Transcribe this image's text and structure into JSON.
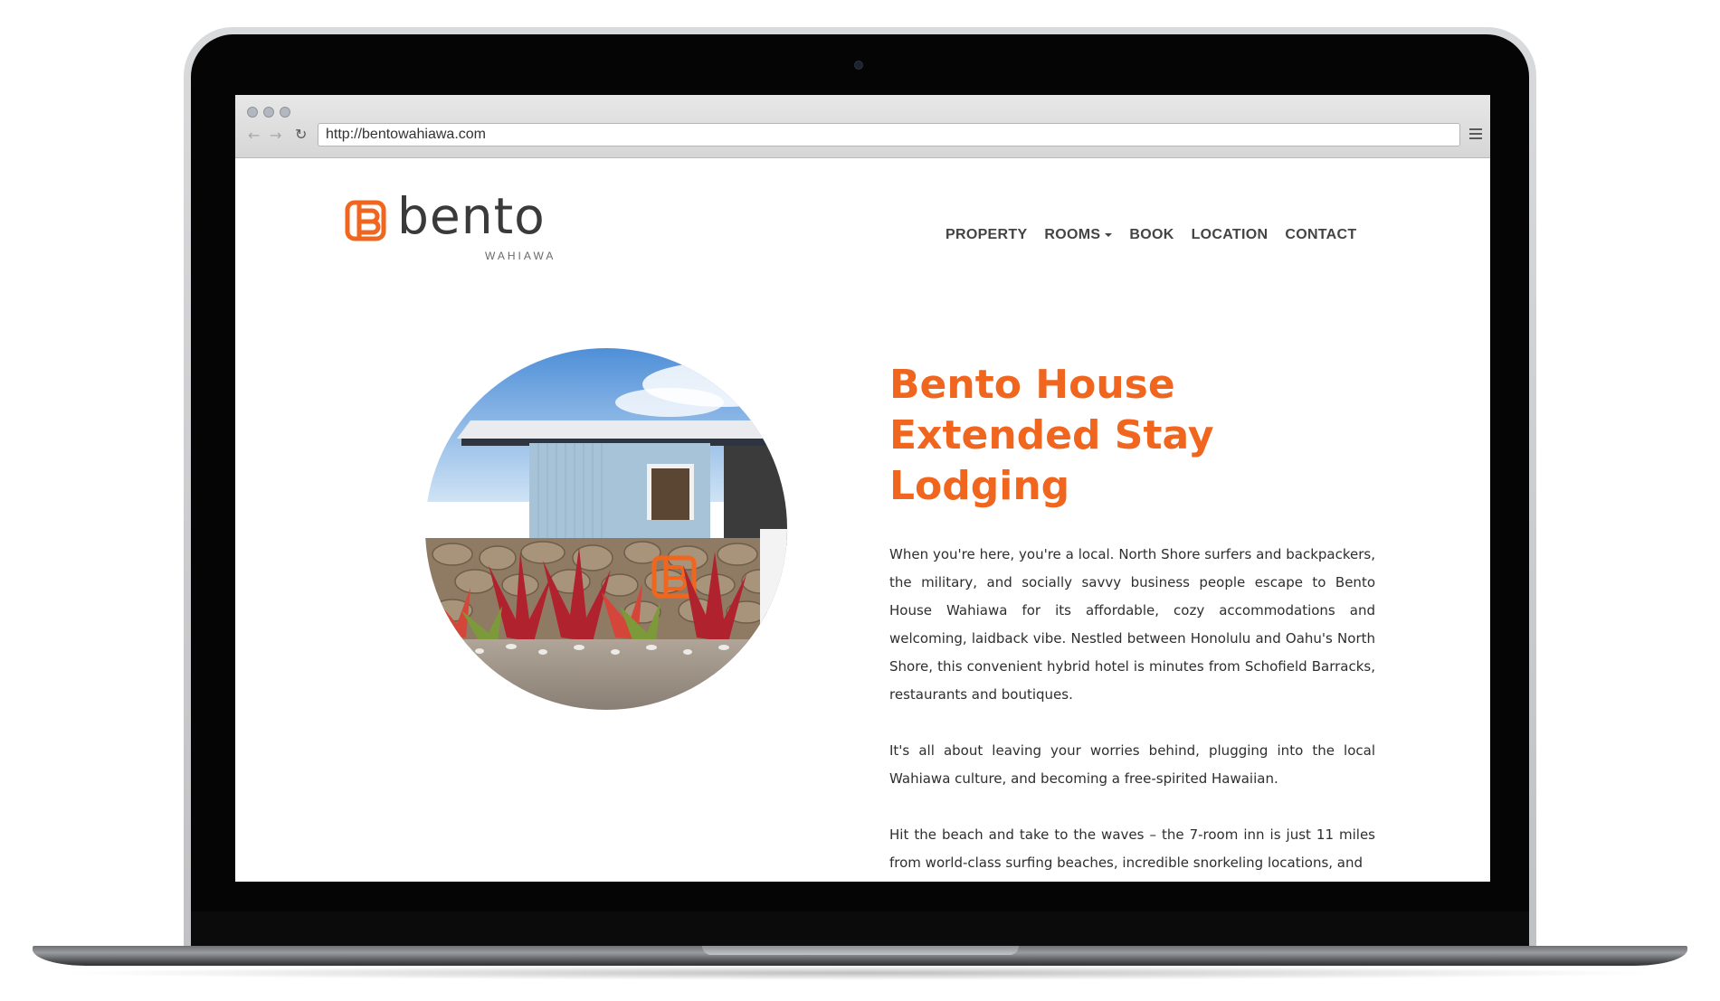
{
  "browser": {
    "url": "http://bentowahiawa.com"
  },
  "site": {
    "logo_word": "bento",
    "logo_sub": "WAHIAWA",
    "brand_color": "#f0661f"
  },
  "nav": {
    "items": [
      {
        "label": "PROPERTY"
      },
      {
        "label": "ROOMS"
      },
      {
        "label": "BOOK"
      },
      {
        "label": "LOCATION"
      },
      {
        "label": "CONTACT"
      }
    ]
  },
  "main": {
    "headline": "Bento House Extended Stay Lodging",
    "paragraphs": [
      "When you're here, you're a local. North Shore surfers and backpackers, the military, and socially savvy business people escape to Bento House Wahiawa for its affordable, cozy accommodations and welcoming, laidback vibe. Nestled between Honolulu and Oahu's North Shore, this convenient hybrid hotel is minutes from Schofield Barracks, restaurants and boutiques.",
      "It's all about leaving your worries behind, plugging into the local Wahiawa culture, and becoming a free-spirited Hawaiian.",
      "Hit the beach and take to the waves – the 7-room inn is just 11 miles from world-class surfing beaches, incredible snorkeling locations, and"
    ]
  }
}
